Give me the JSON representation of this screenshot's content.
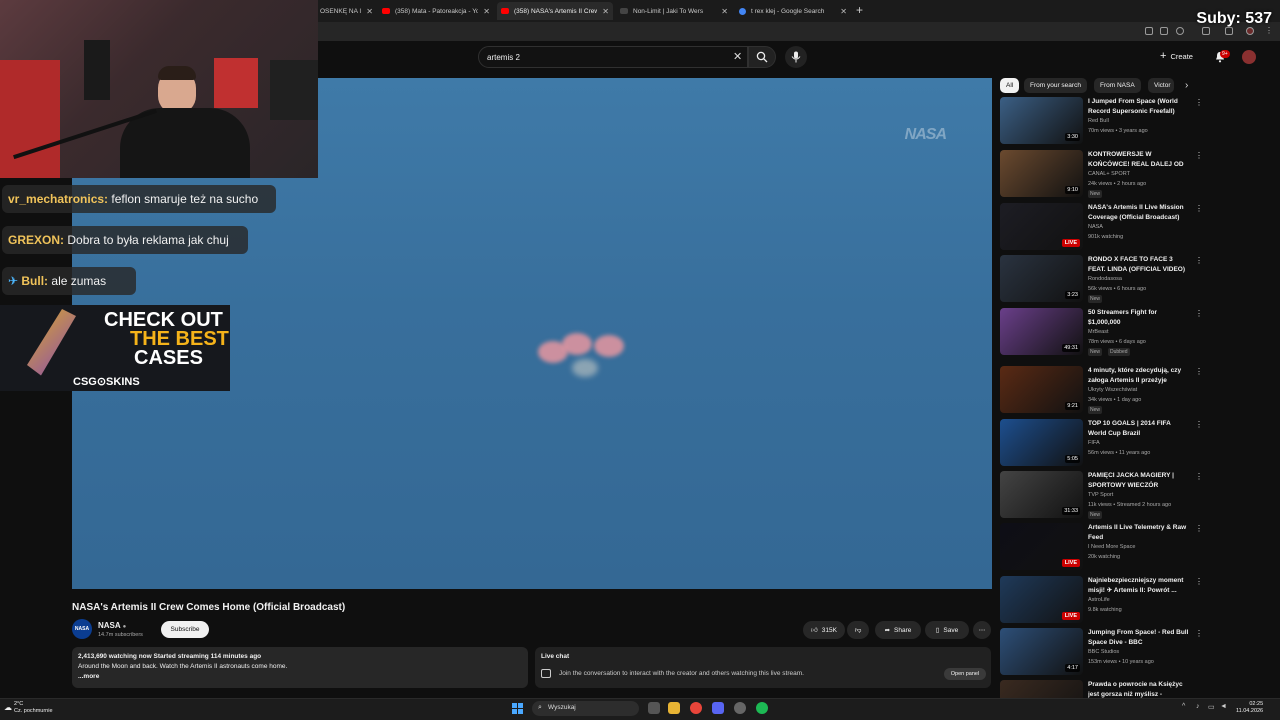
{
  "browser": {
    "tabs": [
      {
        "label": "OSENKĘ NA I",
        "color": "#ff0000"
      },
      {
        "label": "(358) Mata - Patoreakcja - YouT",
        "color": "#ff0000"
      },
      {
        "label": "(358) NASA's Artemis II Crew C",
        "color": "#ff0000",
        "active": true
      },
      {
        "label": "Non-Limit | Jaki To Wers",
        "color": "#222222"
      },
      {
        "label": "t rex klej - Google Search",
        "color": "#4285f4"
      }
    ],
    "new_tab": "+"
  },
  "overlay": {
    "subs": "Suby: 537",
    "chat": [
      {
        "name": "vr_mechatronics:",
        "text": "feflon smaruje też na sucho"
      },
      {
        "name": "GREXON:",
        "text": "Dobra to była reklama jak chuj"
      },
      {
        "name": "Bull:",
        "text": "ale zumas"
      }
    ],
    "ad": {
      "line1": "CHECK OUT",
      "line2": "THE BEST",
      "line3": "CASES",
      "brand": "CSG⊙SKINS"
    }
  },
  "youtube": {
    "search_value": "artemis 2",
    "create": "Create",
    "notifications": "9+",
    "video": {
      "watermark": "NASA",
      "title": "NASA's Artemis II Crew Comes Home (Official Broadcast)",
      "channel": "NASA",
      "channel_avatar": "NASA",
      "subscribers": "14.7m subscribers",
      "subscribe": "Subscribe",
      "likes": "315K",
      "share": "Share",
      "save": "Save",
      "more": "⋯",
      "desc_stats": "2,413,690 watching now  Started streaming 114 minutes ago",
      "desc_text": "Around the Moon and back. Watch the Artemis II astronauts come home.",
      "desc_more": "...more"
    },
    "live_chat": {
      "title": "Live chat",
      "text": "Join the conversation to interact with the creator and others watching this live stream.",
      "open_panel": "Open panel"
    },
    "chips": [
      "All",
      "From your search",
      "From NASA",
      "Victor"
    ],
    "recommendations": [
      {
        "title": "I Jumped From Space (World Record Supersonic Freefall)",
        "channel": "Red Bull",
        "meta": "70m views • 3 years ago",
        "duration": "3:30",
        "thumb": "#3b5f85"
      },
      {
        "title": "KONTROWERSJE W KOŃCÓWCE! REAL DALEJ OD ...",
        "channel": "CANAL+ SPORT",
        "meta": "24k views • 2 hours ago",
        "badge": "New",
        "duration": "9:10",
        "thumb": "#6b4a2f"
      },
      {
        "title": "NASA's Artemis II Live Mission Coverage (Official Broadcast)",
        "channel": "NASA",
        "meta": "901k watching",
        "live": "LIVE",
        "thumb": "#1d1d24"
      },
      {
        "title": "RONDO X FACE TO FACE 3 FEAT. LINDA (OFFICIAL VIDEO)",
        "channel": "Rondodasosa",
        "meta": "56k views • 6 hours ago",
        "badge": "New",
        "duration": "3:23",
        "thumb": "#2a3340"
      },
      {
        "title": "50 Streamers Fight for $1,000,000",
        "channel": "MrBeast",
        "meta": "78m views • 6 days ago",
        "badge": "New",
        "badge2": "Dubbed",
        "duration": "49:31",
        "thumb": "#6a3f8a"
      },
      {
        "title": "4 minuty, które zdecydują, czy załoga Artemis II przeżyje",
        "channel": "Ukryty Wszechświat",
        "meta": "34k views • 1 day ago",
        "badge": "New",
        "duration": "9:21",
        "thumb": "#5a2a14"
      },
      {
        "title": "TOP 10 GOALS | 2014 FIFA World Cup Brazil",
        "channel": "FIFA",
        "meta": "56m views • 11 years ago",
        "duration": "5:05",
        "thumb": "#1d4f8f"
      },
      {
        "title": "PAMIĘCI JACKA MAGIERY | SPORTOWY WIECZÓR",
        "channel": "TVP Sport",
        "meta": "11k views • Streamed 2 hours ago",
        "badge": "New",
        "duration": "31:33",
        "thumb": "#444444"
      },
      {
        "title": "Artemis II Live Telemetry & Raw Feed",
        "channel": "I Need More Space",
        "meta": "20k watching",
        "live": "LIVE",
        "thumb": "#0e0e16"
      },
      {
        "title": "Najniebezpieczniejszy moment misji! ✈ Artemis II: Powrót ...",
        "channel": "AstroLife",
        "meta": "9.8k watching",
        "live": "LIVE",
        "thumb": "#1f3a5a"
      },
      {
        "title": "Jumping From Space! - Red Bull Space Dive - BBC",
        "channel": "BBC Studios",
        "meta": "153m views • 10 years ago",
        "duration": "4:17",
        "thumb": "#2d4f78"
      },
      {
        "title": "Prawda o powrocie na Księżyc jest gorsza niż myślisz -",
        "channel": "",
        "meta": "",
        "thumb": "#3a2a20"
      }
    ]
  },
  "taskbar": {
    "temp": "2°C",
    "weather": "Cz. pochmurnie",
    "search": "Wyszukaj",
    "time": "02:25",
    "date": "11.04.2026"
  }
}
